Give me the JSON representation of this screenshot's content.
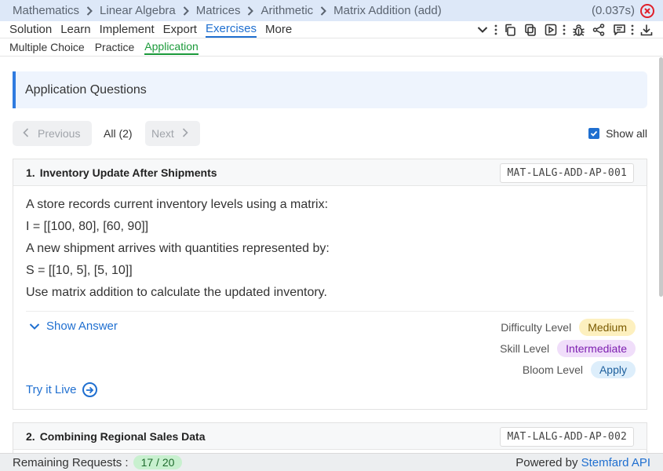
{
  "breadcrumb": {
    "items": [
      "Mathematics",
      "Linear Algebra",
      "Matrices",
      "Arithmetic",
      "Matrix Addition (add)"
    ],
    "timing": "(0.037s)"
  },
  "menu": {
    "items": [
      "Solution",
      "Learn",
      "Implement",
      "Export",
      "Exercises",
      "More"
    ],
    "active": "Exercises",
    "tool_icons": [
      "chevron-down-icon",
      "copy-icon",
      "copy-alt-icon",
      "play-square-icon",
      "bug-icon",
      "share-icon",
      "comment-icon",
      "download-icon"
    ]
  },
  "subtabs": {
    "items": [
      "Multiple Choice",
      "Practice",
      "Application"
    ],
    "active": "Application"
  },
  "section": {
    "title": "Application Questions"
  },
  "pager": {
    "previous": "Previous",
    "all": "All (2)",
    "next": "Next",
    "show_all": "Show all",
    "show_all_checked": true
  },
  "questions": [
    {
      "number": "1.",
      "title": "Inventory Update After Shipments",
      "code": "MAT-LALG-ADD-AP-001",
      "lines": [
        "A store records current inventory levels using a matrix:",
        "I = [[100, 80], [60, 90]]",
        "A new shipment arrives with quantities represented by:",
        "S = [[10, 5], [5, 10]]",
        "Use matrix addition to calculate the updated inventory."
      ],
      "show_answer": "Show Answer",
      "try_it_live": "Try it Live",
      "difficulty_label": "Difficulty Level",
      "difficulty": "Medium",
      "skill_label": "Skill Level",
      "skill": "Intermediate",
      "bloom_label": "Bloom Level",
      "bloom": "Apply"
    },
    {
      "number": "2.",
      "title": "Combining Regional Sales Data",
      "code": "MAT-LALG-ADD-AP-002"
    }
  ],
  "footer": {
    "remaining_label": "Remaining Requests :",
    "remaining_value": "17 / 20",
    "powered_by": "Powered by",
    "brand": "Stemfard API"
  },
  "colors": {
    "accent": "#1f6fd0",
    "active_subtab": "#1b9a3a",
    "close": "#e0202a"
  }
}
